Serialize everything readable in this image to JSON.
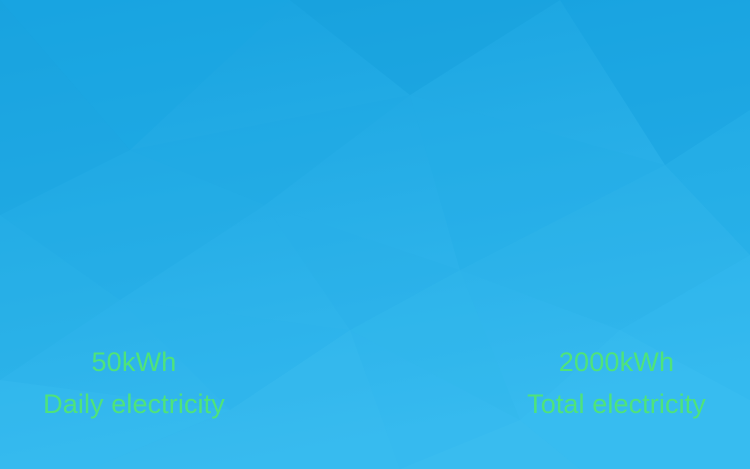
{
  "stats": {
    "daily": {
      "value": "50kWh",
      "label": "Daily electricity"
    },
    "total": {
      "value": "2000kWh",
      "label": "Total electricity"
    }
  },
  "colors": {
    "background_top": "#18a4e0",
    "background_bottom": "#34b8ee",
    "stat_text": "#4fe37a"
  }
}
